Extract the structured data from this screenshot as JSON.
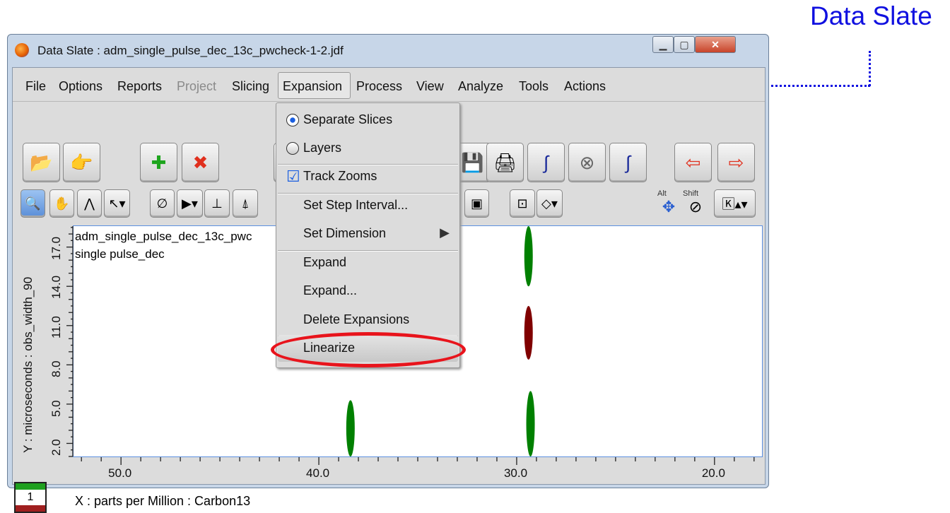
{
  "annotation": {
    "label": "Data Slate",
    "color": "#1010e0"
  },
  "window": {
    "title": "Data Slate : adm_single_pulse_dec_13c_pwcheck-1-2.jdf",
    "controls": [
      "minimize",
      "maximize",
      "close"
    ]
  },
  "menubar": [
    {
      "label": "File"
    },
    {
      "label": "Options"
    },
    {
      "label": "Reports"
    },
    {
      "label": "Project",
      "disabled": true
    },
    {
      "label": "Slicing"
    },
    {
      "label": "Expansion",
      "active": true
    },
    {
      "label": "Process"
    },
    {
      "label": "View"
    },
    {
      "label": "Analyze"
    },
    {
      "label": "Tools"
    },
    {
      "label": "Actions"
    }
  ],
  "toolbar_row1": [
    "folder-open-icon",
    "pointing-hand-icon",
    "add-icon",
    "delete-icon",
    "save-icon",
    "printer-icon",
    "integral-grid-icon",
    "stop-octagon-icon",
    "integral-icon",
    "arrow-left-icon",
    "arrow-right-icon"
  ],
  "toolbar_row2": [
    "zoom-icon",
    "pan-hand-icon",
    "peak-pick-icon",
    "pointer-dropdown-icon",
    "null-icon",
    "arrow-dropdown-icon",
    "baseline-icon",
    "peak-icon",
    "box-icon",
    "center-point-icon",
    "crosshair-dropdown-icon",
    "alt-move-icon",
    "shift-scale-icon",
    "keyboard-icon"
  ],
  "modifiers": {
    "alt": "Alt",
    "shift": "Shift"
  },
  "expansion_menu": {
    "items": [
      {
        "label": "Separate Slices",
        "type": "radio",
        "checked": true
      },
      {
        "label": "Layers",
        "type": "radio",
        "checked": false
      },
      {
        "label": "Track Zooms",
        "type": "check",
        "checked": true
      },
      {
        "label": "Set Step Interval..."
      },
      {
        "label": "Set Dimension",
        "submenu": true
      },
      {
        "label": "Expand"
      },
      {
        "label": "Expand..."
      },
      {
        "label": "Delete Expansions"
      },
      {
        "label": "Linearize",
        "highlighted": true
      }
    ]
  },
  "plot": {
    "filename": "adm_single_pulse_dec_13c_pwc",
    "subtitle": "single pulse_dec",
    "ylabel": "Y : microseconds : obs_width_90",
    "xlabel": "X : parts per Million : Carbon13",
    "xticks": [
      "50.0",
      "40.0",
      "30.0",
      "20.0"
    ],
    "yticks": [
      "2.0",
      "5.0",
      "8.0",
      "11.0",
      "14.0",
      "17.0"
    ],
    "xlim": [
      52.4,
      17.6
    ],
    "ylim": [
      1.0,
      18.6
    ],
    "peaks": [
      {
        "x": 29.4,
        "y0": 14.0,
        "y1": 18.6,
        "color": "#008000"
      },
      {
        "x": 29.4,
        "y0": 8.4,
        "y1": 12.5,
        "color": "#800000"
      },
      {
        "x": 29.3,
        "y0": 1.0,
        "y1": 6.0,
        "color": "#008000"
      },
      {
        "x": 38.4,
        "y0": 1.0,
        "y1": 5.3,
        "color": "#008000"
      }
    ],
    "slice_indicator": "1"
  }
}
